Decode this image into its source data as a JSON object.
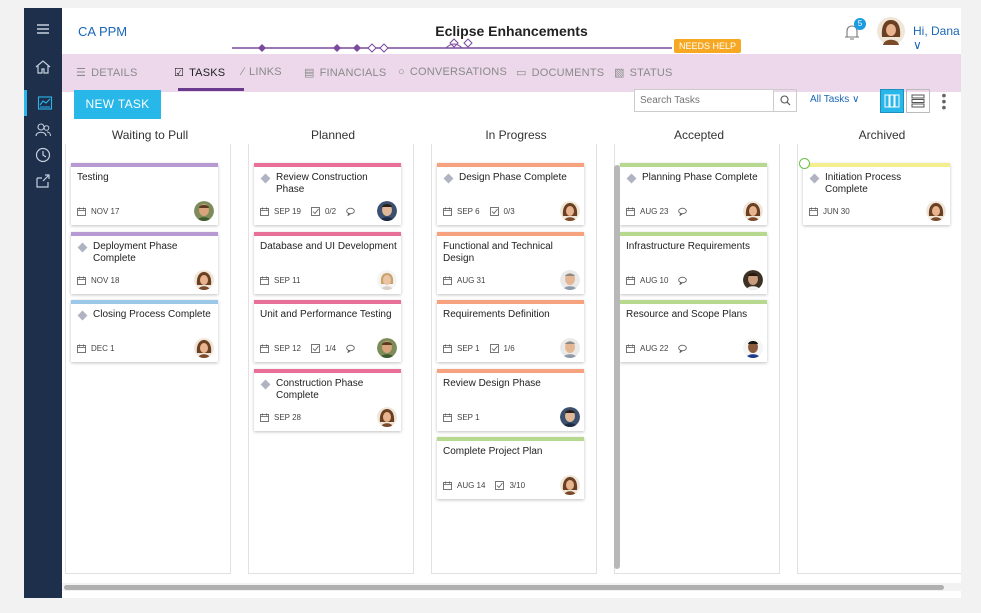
{
  "header": {
    "app_name": "CA PPM",
    "project_title": "Eclipse Enhancements",
    "status_badge": "NEEDS HELP",
    "notification_count": "5",
    "greeting": "Hi, Dana"
  },
  "tabs": [
    {
      "label": "DETAILS",
      "icon": "list-icon"
    },
    {
      "label": "TASKS",
      "icon": "checkbox-icon"
    },
    {
      "label": "LINKS",
      "icon": "link-icon"
    },
    {
      "label": "FINANCIALS",
      "icon": "financials-icon"
    },
    {
      "label": "CONVERSATIONS",
      "icon": "chat-icon"
    },
    {
      "label": "DOCUMENTS",
      "icon": "folder-icon"
    },
    {
      "label": "STATUS",
      "icon": "status-icon"
    }
  ],
  "toolbar": {
    "new_task": "NEW TASK",
    "search_placeholder": "Search Tasks",
    "filter": "All Tasks"
  },
  "colors": {
    "nav_bg": "#1e2f4b",
    "accent": "#27b7e8",
    "tabs_bg": "#ecd8ea",
    "purple": "#b79ad2",
    "pink": "#e86f97",
    "orange": "#f7a27e",
    "green": "#b7d88f",
    "yellow": "#f4ee8e",
    "blue": "#9cc8e8"
  },
  "columns": [
    {
      "title": "Waiting to Pull",
      "cards": [
        {
          "title": "Testing",
          "date": "NOV 17",
          "milestone": false,
          "color": "#b79ad2",
          "checklist": "",
          "comment": false,
          "avatar": "m1"
        },
        {
          "title": "Deployment Phase Complete",
          "date": "NOV 18",
          "milestone": true,
          "color": "#b79ad2",
          "checklist": "",
          "comment": false,
          "avatar": "f1"
        },
        {
          "title": "Closing Process Complete",
          "date": "DEC 1",
          "milestone": true,
          "color": "#9cc8e8",
          "checklist": "",
          "comment": false,
          "avatar": "f1"
        }
      ]
    },
    {
      "title": "Planned",
      "cards": [
        {
          "title": "Review Construction Phase",
          "date": "SEP 19",
          "milestone": true,
          "color": "#e86f97",
          "checklist": "0/2",
          "comment": true,
          "avatar": "m2"
        },
        {
          "title": "Database and UI Development",
          "date": "SEP 11",
          "milestone": false,
          "color": "#e86f97",
          "checklist": "",
          "comment": false,
          "avatar": "f2"
        },
        {
          "title": "Unit and Performance Testing",
          "date": "SEP 12",
          "milestone": false,
          "color": "#e86f97",
          "checklist": "1/4",
          "comment": true,
          "avatar": "m1"
        },
        {
          "title": "Construction Phase Complete",
          "date": "SEP 28",
          "milestone": true,
          "color": "#e86f97",
          "checklist": "",
          "comment": false,
          "avatar": "f1"
        }
      ]
    },
    {
      "title": "In Progress",
      "cards": [
        {
          "title": "Design Phase Complete",
          "date": "SEP 6",
          "milestone": true,
          "color": "#f7a27e",
          "checklist": "0/3",
          "comment": false,
          "avatar": "f1"
        },
        {
          "title": "Functional and Technical Design",
          "date": "AUG 31",
          "milestone": false,
          "color": "#f7a27e",
          "checklist": "",
          "comment": false,
          "avatar": "m3"
        },
        {
          "title": "Requirements Definition",
          "date": "SEP 1",
          "milestone": false,
          "color": "#f7a27e",
          "checklist": "1/6",
          "comment": false,
          "avatar": "m3"
        },
        {
          "title": "Review Design Phase",
          "date": "SEP 1",
          "milestone": false,
          "color": "#f7a27e",
          "checklist": "",
          "comment": false,
          "avatar": "m2"
        },
        {
          "title": "Complete Project Plan",
          "date": "AUG 14",
          "milestone": false,
          "color": "#b7d88f",
          "checklist": "3/10",
          "comment": false,
          "avatar": "f1"
        }
      ]
    },
    {
      "title": "Accepted",
      "cards": [
        {
          "title": "Planning Phase Complete",
          "date": "AUG 23",
          "milestone": true,
          "color": "#b7d88f",
          "checklist": "",
          "comment": true,
          "avatar": "f1"
        },
        {
          "title": "Infrastructure Requirements",
          "date": "AUG 10",
          "milestone": false,
          "color": "#b7d88f",
          "checklist": "",
          "comment": true,
          "avatar": "m4"
        },
        {
          "title": "Resource and Scope Plans",
          "date": "AUG 22",
          "milestone": false,
          "color": "#b7d88f",
          "checklist": "",
          "comment": true,
          "avatar": "m5"
        }
      ]
    },
    {
      "title": "Archived",
      "cards": [
        {
          "title": "Initiation Process Complete",
          "date": "JUN 30",
          "milestone": true,
          "color": "#f4ee8e",
          "checklist": "",
          "comment": false,
          "avatar": "f1",
          "done": true
        }
      ]
    }
  ]
}
